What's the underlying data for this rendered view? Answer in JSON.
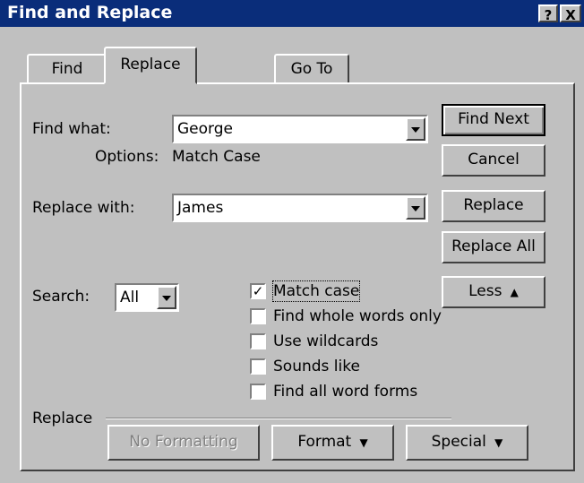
{
  "window": {
    "title": "Find and Replace",
    "help_button": "?",
    "close_button": "X"
  },
  "tabs": [
    {
      "label": "Find"
    },
    {
      "label": "Replace"
    },
    {
      "label": "Go To"
    }
  ],
  "find": {
    "label": "Find what:",
    "value": "George",
    "options_label": "Options:",
    "options_value": "Match Case"
  },
  "replace": {
    "label": "Replace with:",
    "value": "James"
  },
  "search": {
    "label": "Search:",
    "value": "All"
  },
  "options": [
    {
      "label": "Match case",
      "checked": true
    },
    {
      "label": "Find whole words only",
      "checked": false
    },
    {
      "label": "Use wildcards",
      "checked": false
    },
    {
      "label": "Sounds like",
      "checked": false
    },
    {
      "label": "Find all word forms",
      "checked": false
    }
  ],
  "buttons": {
    "find_next": "Find Next",
    "cancel": "Cancel",
    "replace": "Replace",
    "replace_all": "Replace All",
    "less": "Less"
  },
  "replace_section": {
    "label": "Replace",
    "no_formatting": "No Formatting",
    "format": "Format",
    "special": "Special"
  }
}
